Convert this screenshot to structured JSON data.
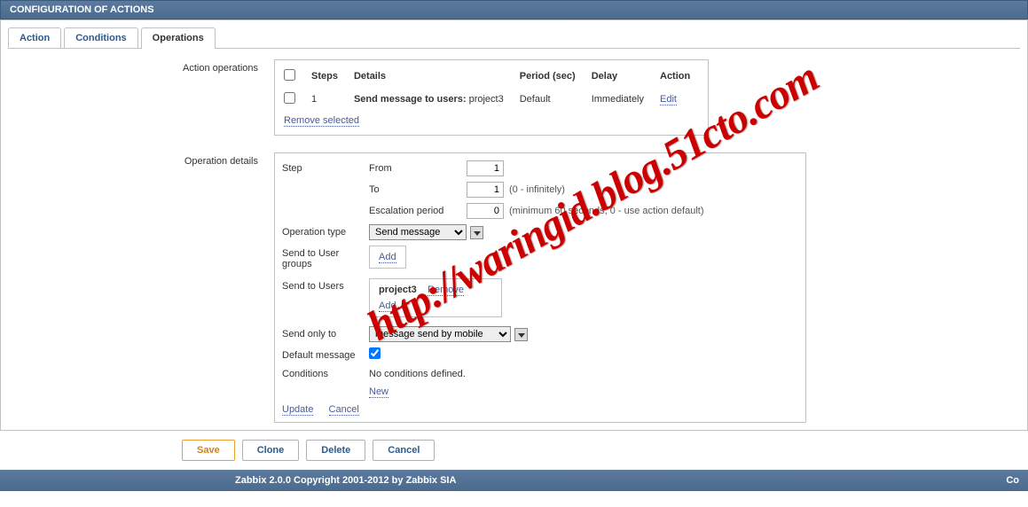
{
  "header": {
    "title": "CONFIGURATION OF ACTIONS"
  },
  "tabs": {
    "action": "Action",
    "conditions": "Conditions",
    "operations": "Operations"
  },
  "section_labels": {
    "action_operations": "Action operations",
    "operation_details": "Operation details"
  },
  "operations_table": {
    "headers": {
      "steps": "Steps",
      "details": "Details",
      "period": "Period (sec)",
      "delay": "Delay",
      "action": "Action"
    },
    "rows": [
      {
        "step": "1",
        "details_label": "Send message to users:",
        "details_value": "project3",
        "period": "Default",
        "delay": "Immediately",
        "action": "Edit"
      }
    ],
    "remove_selected": "Remove selected"
  },
  "details": {
    "step_label": "Step",
    "from_label": "From",
    "from_value": "1",
    "to_label": "To",
    "to_value": "1",
    "to_hint": "(0 - infinitely)",
    "escalation_label": "Escalation period",
    "escalation_value": "0",
    "escalation_hint": "(minimum 60 seconds, 0 - use action default)",
    "operation_type_label": "Operation type",
    "operation_type_value": "Send message",
    "send_user_groups_label": "Send to User groups",
    "send_users_label": "Send to Users",
    "user_name": "project3",
    "remove": "Remove",
    "add": "Add",
    "send_only_to_label": "Send only to",
    "send_only_to_value": "message send by mobile",
    "default_message_label": "Default message",
    "conditions_label": "Conditions",
    "conditions_text": "No conditions defined.",
    "new": "New",
    "update": "Update",
    "cancel": "Cancel"
  },
  "buttons": {
    "save": "Save",
    "clone": "Clone",
    "delete": "Delete",
    "cancel": "Cancel"
  },
  "footer": {
    "copyright": "Zabbix 2.0.0 Copyright 2001-2012 by Zabbix SIA",
    "right": "Co"
  },
  "watermark": "http://waringid.blog.51cto.com"
}
